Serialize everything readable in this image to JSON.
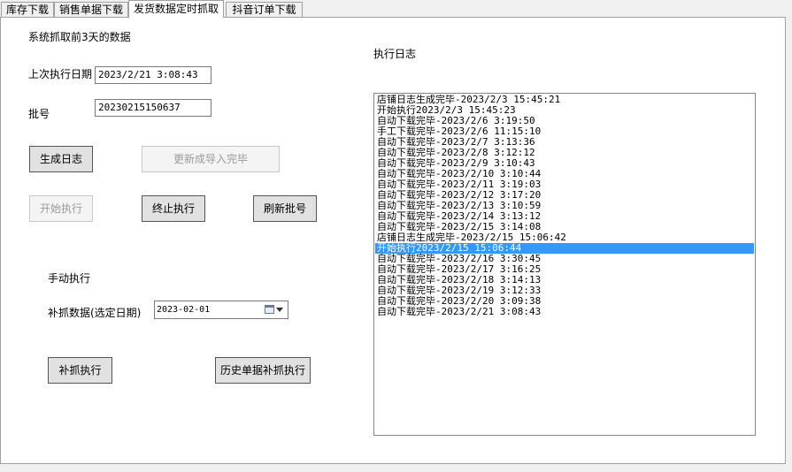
{
  "tabs": [
    "库存下载",
    "销售单据下载",
    "发货数据定时抓取",
    "抖音订单下载"
  ],
  "active_tab": 2,
  "form": {
    "note": "系统抓取前3天的数据",
    "last_exec_label": "上次执行日期",
    "last_exec_value": "2023/2/21 3:08:43",
    "batch_label": "批号",
    "batch_value": "20230215150637"
  },
  "buttons": {
    "gen_log": "生成日志",
    "update_done": "更新成导入完毕",
    "start": "开始执行",
    "stop": "终止执行",
    "refresh_batch": "刷新批号",
    "supplement_exec": "补抓执行",
    "history_exec": "历史单据补抓执行"
  },
  "manual": {
    "title": "手动执行",
    "date_label": "补抓数据(选定日期)",
    "date_value": "2023-02-01"
  },
  "log": {
    "title": "执行日志",
    "selected_index": 14,
    "items": [
      "店铺日志生成完毕-2023/2/3 15:45:21",
      "开始执行2023/2/3 15:45:23",
      "自动下载完毕-2023/2/6 3:19:50",
      "手工下载完毕-2023/2/6 11:15:10",
      "自动下载完毕-2023/2/7 3:13:36",
      "自动下载完毕-2023/2/8 3:12:12",
      "自动下载完毕-2023/2/9 3:10:43",
      "自动下载完毕-2023/2/10 3:10:44",
      "自动下载完毕-2023/2/11 3:19:03",
      "自动下载完毕-2023/2/12 3:17:20",
      "自动下载完毕-2023/2/13 3:10:59",
      "自动下载完毕-2023/2/14 3:13:12",
      "自动下载完毕-2023/2/15 3:14:08",
      "店铺日志生成完毕-2023/2/15 15:06:42",
      "开始执行2023/2/15 15:06:44",
      "自动下载完毕-2023/2/16 3:30:45",
      "自动下载完毕-2023/2/17 3:16:25",
      "自动下载完毕-2023/2/18 3:14:13",
      "自动下载完毕-2023/2/19 3:12:33",
      "自动下载完毕-2023/2/20 3:09:38",
      "自动下载完毕-2023/2/21 3:08:43"
    ]
  }
}
